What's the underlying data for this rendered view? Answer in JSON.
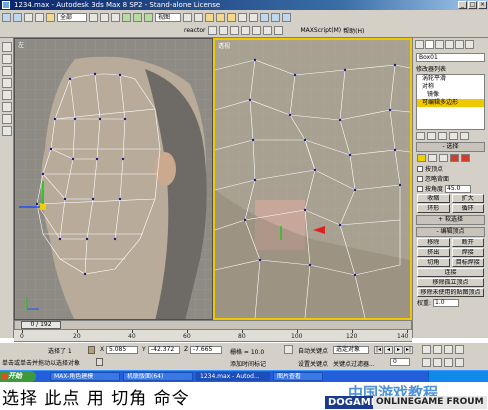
{
  "window": {
    "title": "1234.max - Autodesk 3ds Max 8 SP2 - Stand-alone License",
    "controls": [
      "_",
      "□",
      "×"
    ]
  },
  "toolbar": {
    "selection_filter": "全部",
    "view_dropdown": "视图",
    "reactor_label": "reactor",
    "maxscript_label": "MAXScript(M)",
    "help_label": "帮助(H)"
  },
  "viewports": {
    "left_label": "左",
    "right_label": "透视"
  },
  "command_panel": {
    "object_name": "Box01",
    "modifier_list_label": "修改器列表",
    "modifier_stack": [
      {
        "label": "涡轮平滑",
        "selected": false
      },
      {
        "label": "对称",
        "selected": false
      },
      {
        "label": "镜像",
        "selected": false
      },
      {
        "label": "可编辑多边形",
        "selected": true
      }
    ],
    "selection_rollout": "选择",
    "by_vertex_label": "按顶点",
    "ignore_backfacing_label": "忽略背面",
    "by_angle_label": "按角度",
    "by_angle_value": "45.0",
    "shrink_label": "收缩",
    "grow_label": "扩大",
    "ring_label": "环形",
    "loop_label": "循环",
    "soft_selection_rollout": "软选择",
    "edit_vertices_rollout": "编辑顶点",
    "remove_label": "移除",
    "break_label": "断开",
    "extrude_label": "挤出",
    "weld_label": "焊接",
    "chamfer_label": "切角",
    "target_weld_label": "目标焊接",
    "connect_label": "连接",
    "remove_isolated_label": "移除孤立顶点",
    "remove_unused_map_label": "移除未使用的贴图顶点",
    "weight_label": "权重:",
    "weight_value": "1.0"
  },
  "timeline": {
    "frame_display": "0 / 192",
    "ticks": [
      "0",
      "20",
      "40",
      "60",
      "80",
      "100",
      "120",
      "140"
    ]
  },
  "statusbar": {
    "selected_label": "选择了 1",
    "x_label": "X",
    "x_value": "5.085",
    "y_label": "Y",
    "y_value": "-42.372",
    "z_label": "Z",
    "z_value": "-7.665",
    "grid_label": "栅格 = 10.0",
    "autokey_label": "自动关键点",
    "selected_object_dropdown": "选定对象",
    "setkey_label": "设置关键点",
    "key_filters_label": "关键点过滤器...",
    "prompt_text": "单击或单击并拖动以选择对象",
    "add_time_tag": "添加时间标记",
    "frame_value": "0"
  },
  "taskbar": {
    "start_label": "开始",
    "items": [
      "MAX-角色建模",
      "机联版面(64)",
      "1234.max - Autod...",
      "图片查看"
    ],
    "active_index": 2
  },
  "caption": {
    "text": "选择  此点    用  切角  命令"
  },
  "watermark": {
    "cn_text": "中国游戏教程",
    "brand": "DOGAME",
    "site": "ONLINEGAME FROUM"
  },
  "colors": {
    "active_viewport_border": "#f0c800",
    "selected_modifier": "#f0c800",
    "vertex_marker": "#1a1a8a",
    "wire": "#ffffff"
  }
}
